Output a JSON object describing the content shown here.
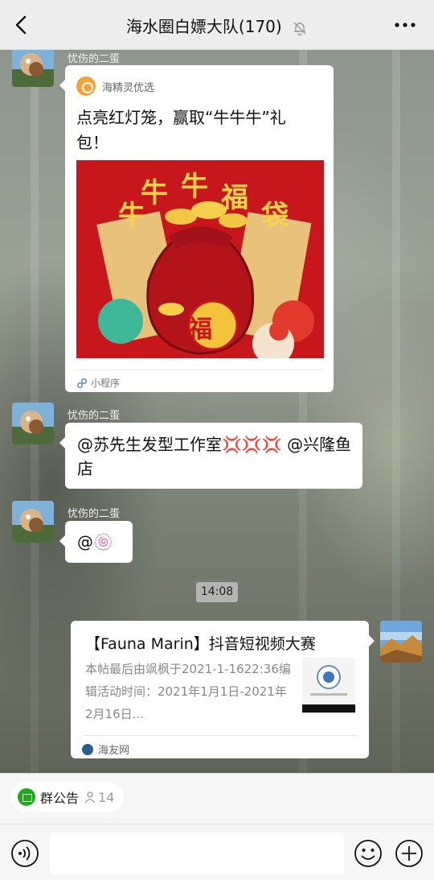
{
  "header": {
    "title": "海水圈白嫖大队(170)",
    "back_icon": "chevron-left-icon",
    "mute_icon": "bell-off-icon",
    "more_icon": "more-dots-icon"
  },
  "messages": [
    {
      "sender": "忧伤的二蛋",
      "type": "mini-program",
      "app_name": "海精灵优选",
      "title": "点亮红灯笼，赢取“牛牛牛”礼包！",
      "cover_text": [
        "牛",
        "牛",
        "牛",
        "福",
        "袋"
      ],
      "cover_bag_char": "福",
      "footer": "小程序"
    },
    {
      "sender": "忧伤的二蛋",
      "type": "text",
      "text": "@苏先生发型工作室💢💢💢 @兴隆鱼店"
    },
    {
      "sender": "忧伤的二蛋",
      "type": "text",
      "text": "@🍥"
    }
  ],
  "time_divider": "14:08",
  "link_message": {
    "title": "【Fauna Marin】抖音短视频大赛",
    "description": "本帖最后由飒枫于2021-1-1622:36编辑活动时间：2021年1月1日-2021年2月16日...",
    "source": "海友网"
  },
  "bottom": {
    "notice_label": "群公告",
    "notice_count": "14",
    "voice_icon": "voice-icon",
    "emoji_icon": "emoji-icon",
    "plus_icon": "plus-icon"
  },
  "colors": {
    "header_bg": "#ededed",
    "bubble_bg": "#ffffff",
    "accent_green": "#1aad19",
    "cover_red": "#c8161d"
  }
}
